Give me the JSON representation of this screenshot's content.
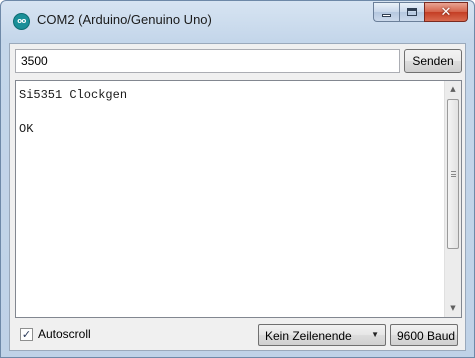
{
  "window": {
    "title": "COM2 (Arduino/Genuino Uno)",
    "app_icon_text": "oo",
    "controls": {
      "minimize": "minimize",
      "maximize": "maximize",
      "close": "✕"
    }
  },
  "input": {
    "value": "3500"
  },
  "send_button": {
    "label": "Senden"
  },
  "output": {
    "lines": [
      "Si5351 Clockgen",
      "",
      "OK"
    ]
  },
  "footer": {
    "autoscroll_label": "Autoscroll",
    "autoscroll_checked": true,
    "line_ending": "Kein Zeilenende",
    "baud": "9600 Baud"
  },
  "colors": {
    "titlebar": "#c4d6ea",
    "close_button": "#c43d24",
    "client_bg": "#f0f0f0"
  }
}
